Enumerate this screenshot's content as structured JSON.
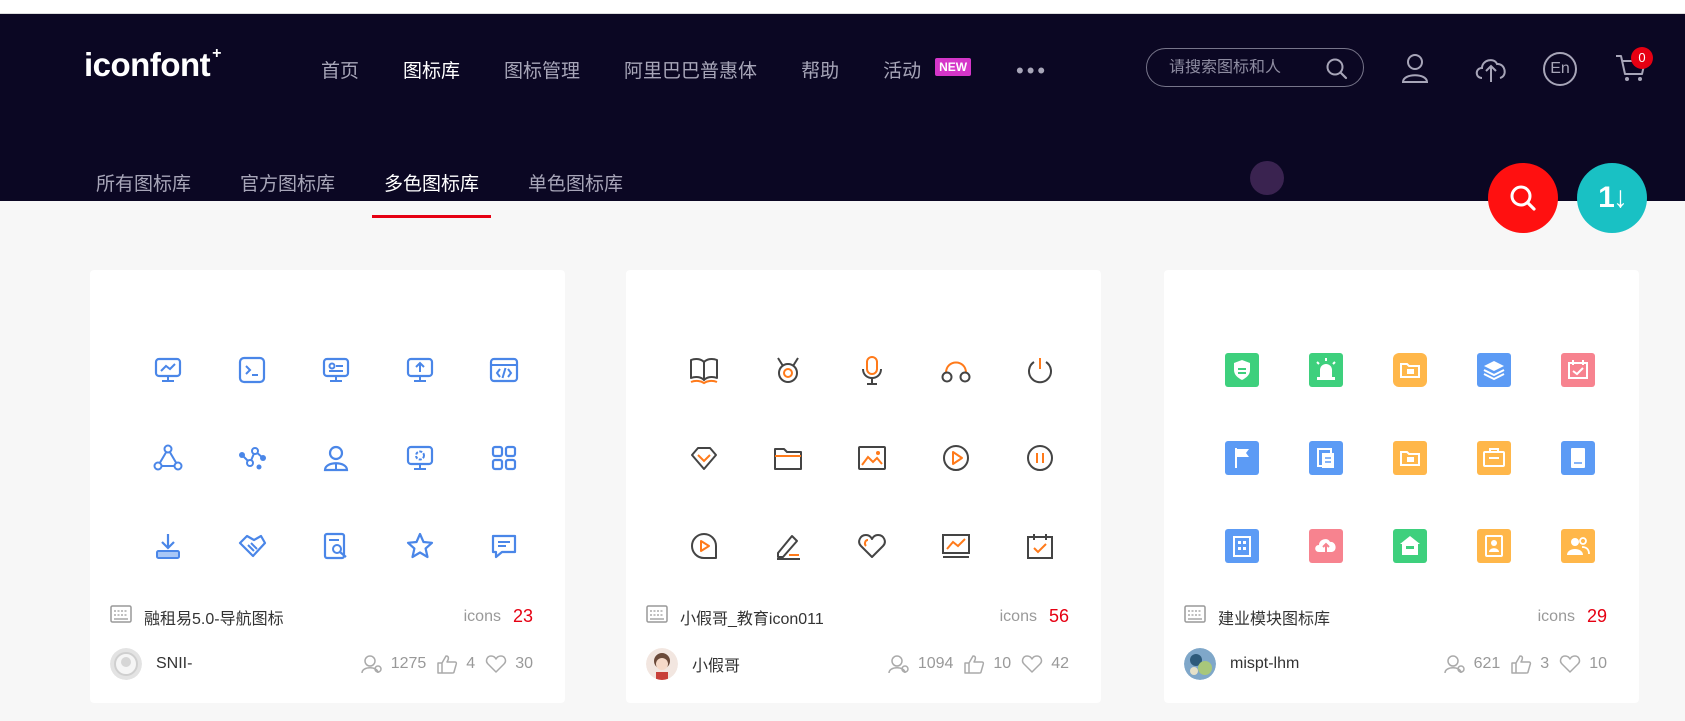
{
  "brand": {
    "logo_text": "iconfont",
    "logo_plus": "+"
  },
  "nav": {
    "items": [
      "首页",
      "图标库",
      "图标管理",
      "阿里巴巴普惠体",
      "帮助",
      "活动"
    ],
    "active_index": 1,
    "new_badge": "NEW",
    "more": "•••"
  },
  "search": {
    "placeholder": "请搜索图标和人"
  },
  "header_icons": {
    "lang": "En",
    "cart_count": "0"
  },
  "subnav": {
    "items": [
      "所有图标库",
      "官方图标库",
      "多色图标库",
      "单色图标库"
    ],
    "active_index": 2
  },
  "colors": {
    "header_bg": "#0b0723",
    "accent_red": "#e60012",
    "fab_search": "#ff1010",
    "fab_sort": "#19c1c4",
    "card1_icon": "#4a86e8",
    "card2_icon_dark": "#444444",
    "card2_icon_orange": "#ff7a1a"
  },
  "fab_sort_glyph": "1↓",
  "cards": [
    {
      "title": "融租易5.0-导航图标",
      "icons_label": "icons",
      "icons_count": "23",
      "user": "SNII-",
      "followers": "1275",
      "likes": "4",
      "favorites": "30"
    },
    {
      "title": "小假哥_教育icon011",
      "icons_label": "icons",
      "icons_count": "56",
      "user": "小假哥",
      "followers": "1094",
      "likes": "10",
      "favorites": "42"
    },
    {
      "title": "建业模块图标库",
      "icons_label": "icons",
      "icons_count": "29",
      "user": "mispt-lhm",
      "followers": "621",
      "likes": "3",
      "favorites": "10"
    }
  ]
}
